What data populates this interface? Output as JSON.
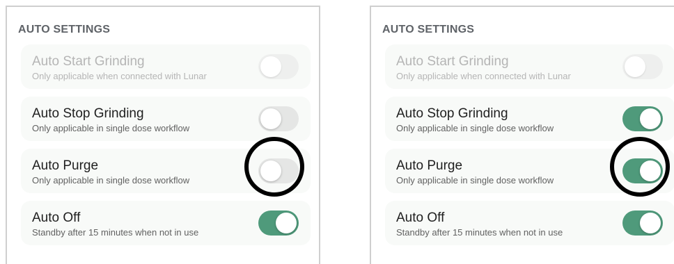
{
  "panels": [
    {
      "section_title": "AUTO SETTINGS",
      "items": [
        {
          "title": "Auto Start Grinding",
          "subtitle": "Only applicable when connected with Lunar",
          "on": false,
          "disabled": true
        },
        {
          "title": "Auto Stop Grinding",
          "subtitle": "Only applicable in single dose workflow",
          "on": false,
          "disabled": false
        },
        {
          "title": "Auto Purge",
          "subtitle": "Only applicable in single dose workflow",
          "on": false,
          "disabled": false,
          "highlighted": true
        },
        {
          "title": "Auto Off",
          "subtitle": "Standby after 15 minutes when not in use",
          "on": true,
          "disabled": false
        }
      ]
    },
    {
      "section_title": "AUTO SETTINGS",
      "items": [
        {
          "title": "Auto Start Grinding",
          "subtitle": "Only applicable when connected with Lunar",
          "on": false,
          "disabled": true
        },
        {
          "title": "Auto Stop Grinding",
          "subtitle": "Only applicable in single dose workflow",
          "on": true,
          "disabled": false
        },
        {
          "title": "Auto Purge",
          "subtitle": "Only applicable in single dose workflow",
          "on": true,
          "disabled": false,
          "highlighted": true
        },
        {
          "title": "Auto Off",
          "subtitle": "Standby after 15 minutes when not in use",
          "on": true,
          "disabled": false
        }
      ]
    }
  ],
  "colors": {
    "toggle_on": "#4f9a7b",
    "toggle_off": "#e5e6e5",
    "highlight_ring": "#000000"
  }
}
